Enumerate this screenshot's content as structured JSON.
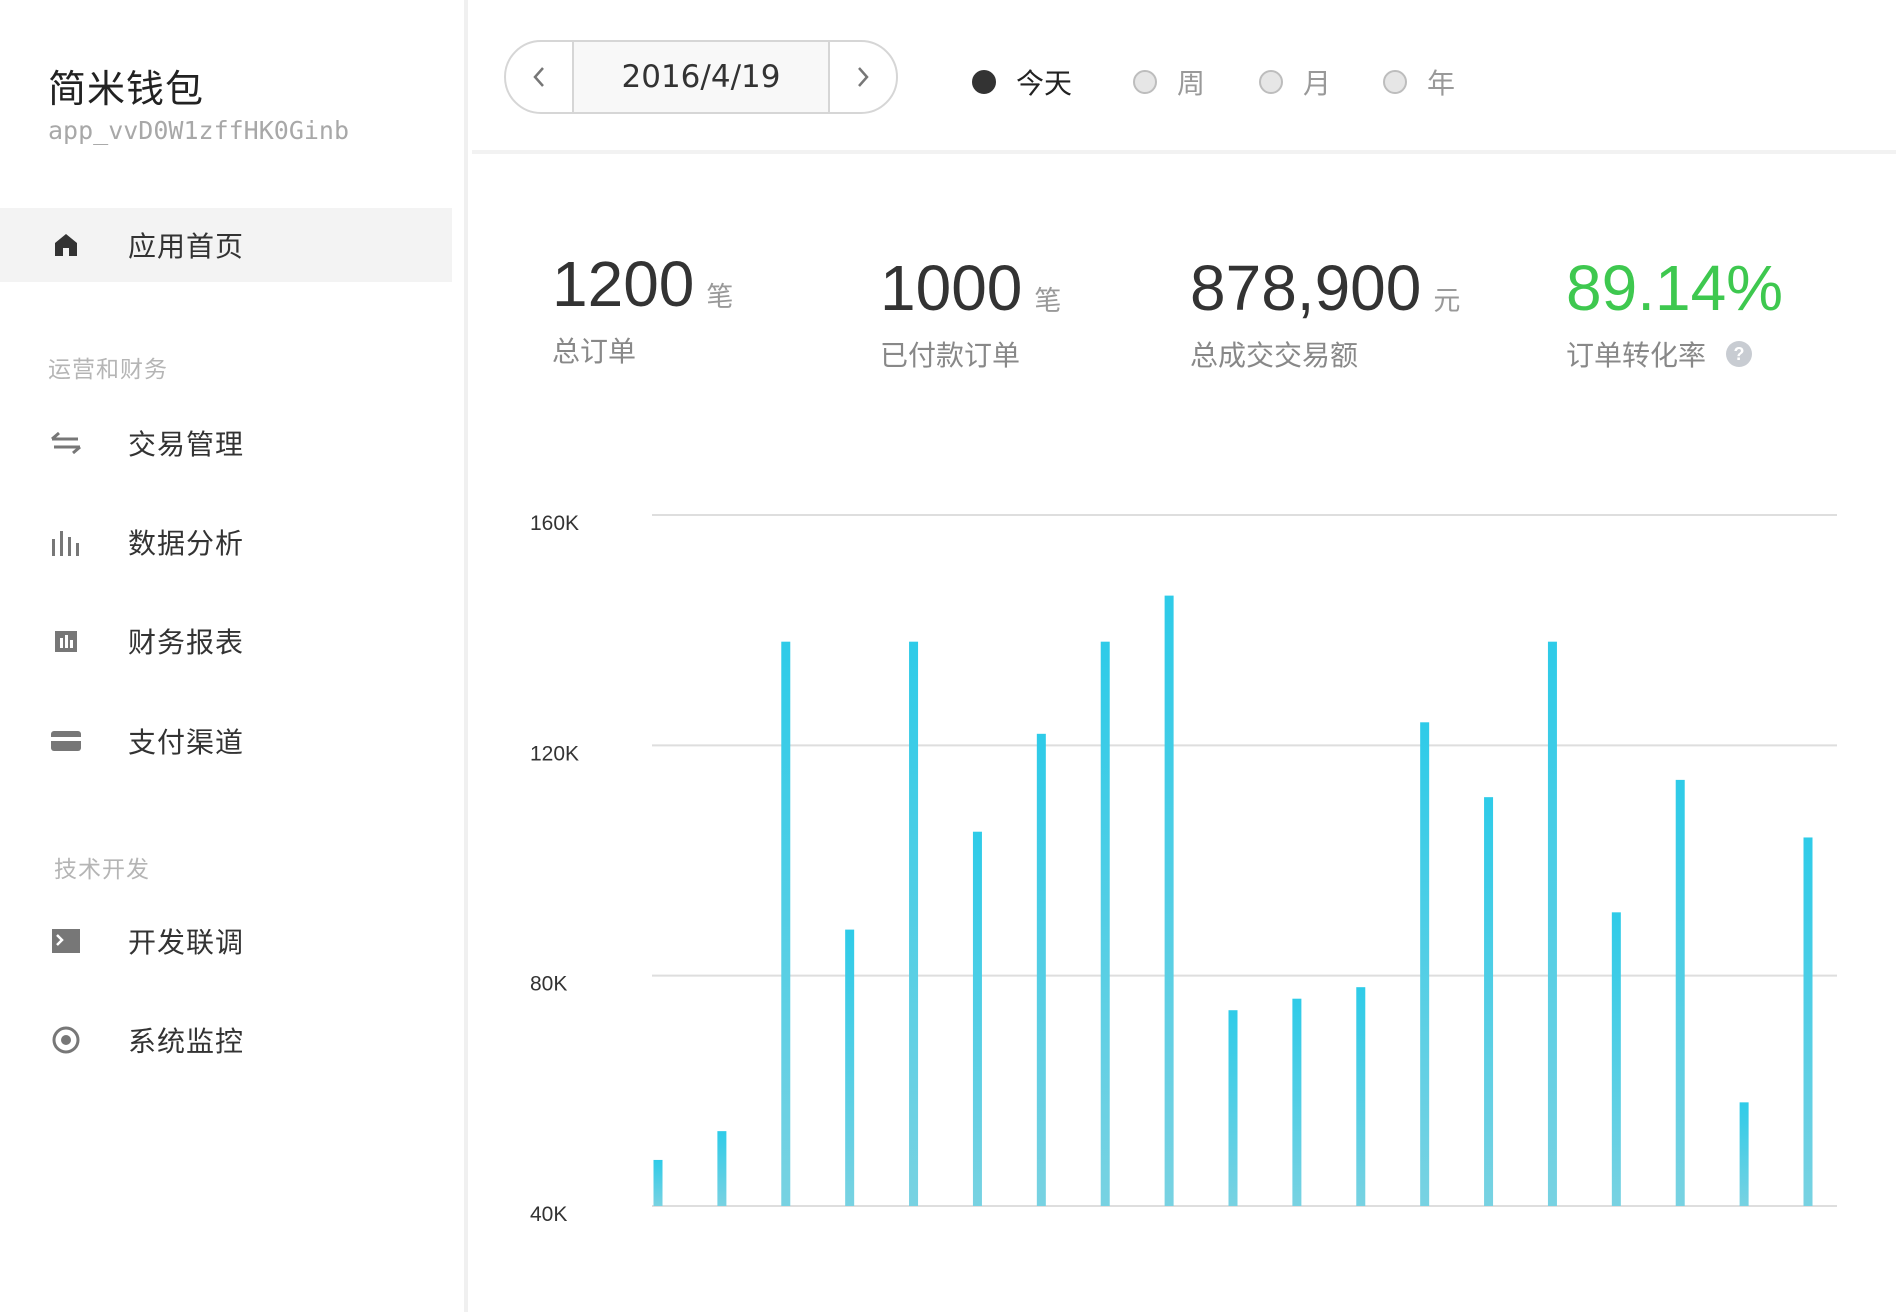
{
  "app": {
    "name": "简米钱包",
    "id": "app_vvD0W1zffHK0Ginb"
  },
  "sidebar": {
    "home": {
      "label": "应用首页",
      "icon": "home-icon",
      "active": true
    },
    "sections": [
      {
        "title": "运营和财务",
        "items": [
          {
            "label": "交易管理",
            "icon": "transfer-arrows-icon"
          },
          {
            "label": "数据分析",
            "icon": "bar-chart-icon"
          },
          {
            "label": "财务报表",
            "icon": "report-icon"
          },
          {
            "label": "支付渠道",
            "icon": "credit-card-icon"
          }
        ]
      },
      {
        "title": "技术开发",
        "items": [
          {
            "label": "开发联调",
            "icon": "terminal-icon"
          },
          {
            "label": "系统监控",
            "icon": "target-icon"
          }
        ]
      }
    ]
  },
  "header": {
    "date": "2016/4/19",
    "ranges": [
      {
        "label": "今天",
        "checked": true
      },
      {
        "label": "周",
        "checked": false
      },
      {
        "label": "月",
        "checked": false
      },
      {
        "label": "年",
        "checked": false
      }
    ]
  },
  "stats": [
    {
      "value": "1200",
      "unit": "笔",
      "label": "总订单"
    },
    {
      "value": "1000",
      "unit": "笔",
      "label": "已付款订单"
    },
    {
      "value": "878,900",
      "unit": "元",
      "label": "总成交交易额"
    },
    {
      "value": "89.14%",
      "unit": "",
      "label": "订单转化率",
      "color": "#3ec84f",
      "help": "?"
    }
  ],
  "colors": {
    "bar_top": "#2ecbe8",
    "bar_bottom": "#78d2e2",
    "positive": "#3ec84f"
  },
  "chart_data": {
    "type": "bar",
    "ylim": [
      40000,
      160000
    ],
    "yticks": [
      {
        "value": 40000,
        "label": "40K"
      },
      {
        "value": 80000,
        "label": "80K"
      },
      {
        "value": 120000,
        "label": "120K"
      },
      {
        "value": 160000,
        "label": "160K"
      }
    ],
    "grid": true,
    "values": [
      48000,
      53000,
      138000,
      88000,
      138000,
      105000,
      122000,
      138000,
      146000,
      74000,
      76000,
      78000,
      124000,
      111000,
      138000,
      91000,
      114000,
      58000,
      104000
    ]
  }
}
